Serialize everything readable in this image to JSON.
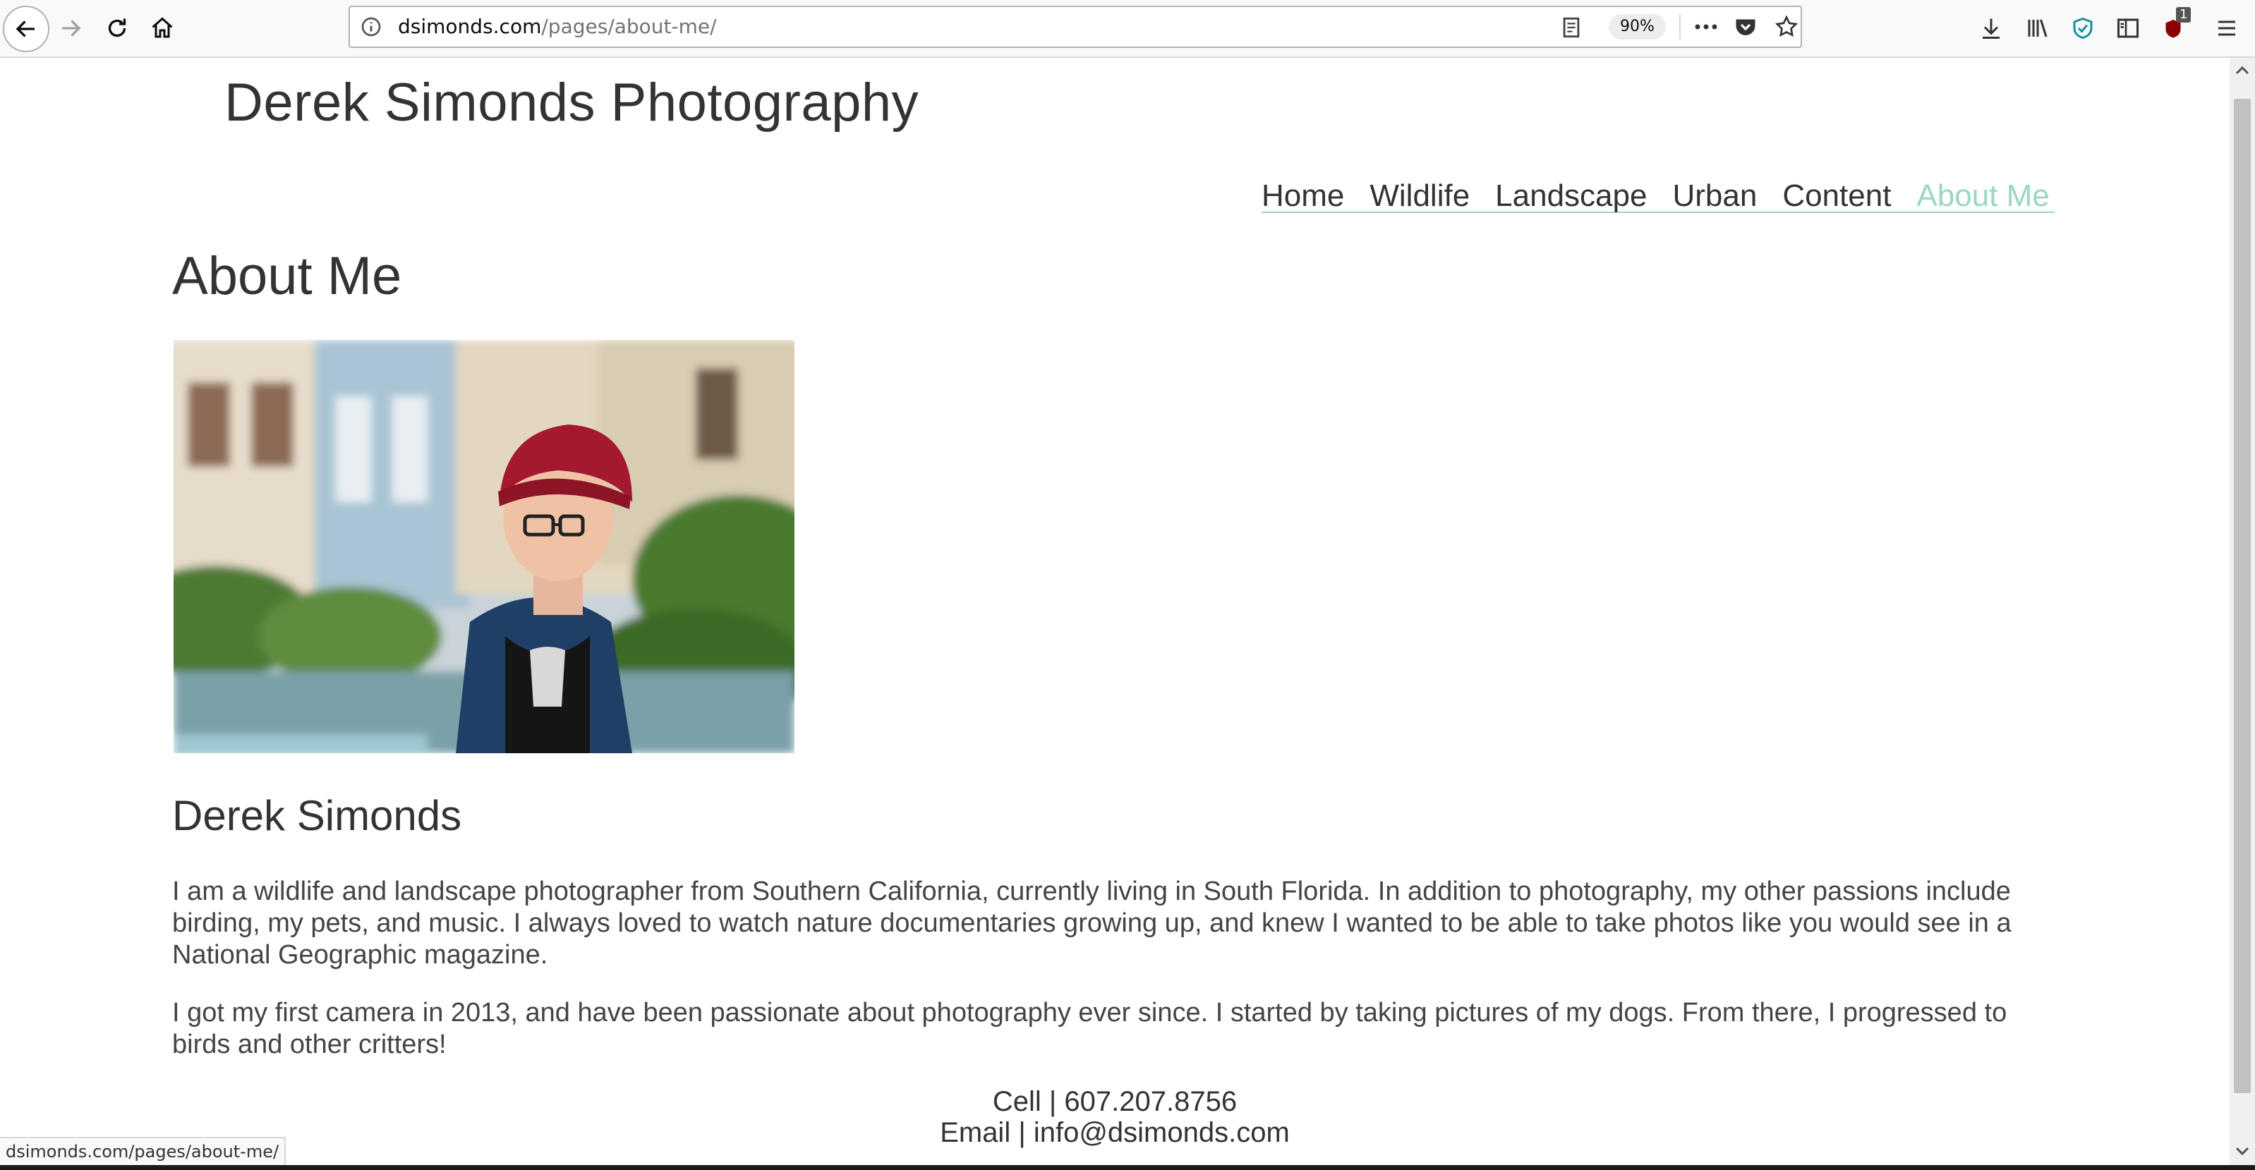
{
  "browser": {
    "url_host": "dsimonds.com",
    "url_path": "/pages/about-me/",
    "zoom": "90%",
    "extension_badge": "1",
    "status_text": "dsimonds.com/pages/about-me/"
  },
  "site": {
    "title": "Derek Simonds Photography",
    "nav": [
      {
        "label": "Home"
      },
      {
        "label": "Wildlife"
      },
      {
        "label": "Landscape"
      },
      {
        "label": "Urban"
      },
      {
        "label": "Content"
      },
      {
        "label": "About Me",
        "active": true
      }
    ],
    "accent_color": "#9bd6c5"
  },
  "main": {
    "heading": "About Me",
    "portrait_alt": "Portrait of Derek Simonds wearing a red beanie and glasses",
    "name": "Derek Simonds",
    "bio": [
      "I am a wildlife and landscape photographer from Southern California, currently living in South Florida. In addition to photography, my other passions include birding, my pets, and music. I always loved to watch nature documentaries growing up, and knew I wanted to be able to take photos like you would see in a National Geographic magazine.",
      "I got my first camera in 2013, and have been passionate about photography ever since. I started by taking pictures of my dogs. From there, I progressed to birds and other critters!"
    ],
    "contact_cell": "Cell | 607.207.8756",
    "contact_email": "Email | info@dsimonds.com"
  }
}
